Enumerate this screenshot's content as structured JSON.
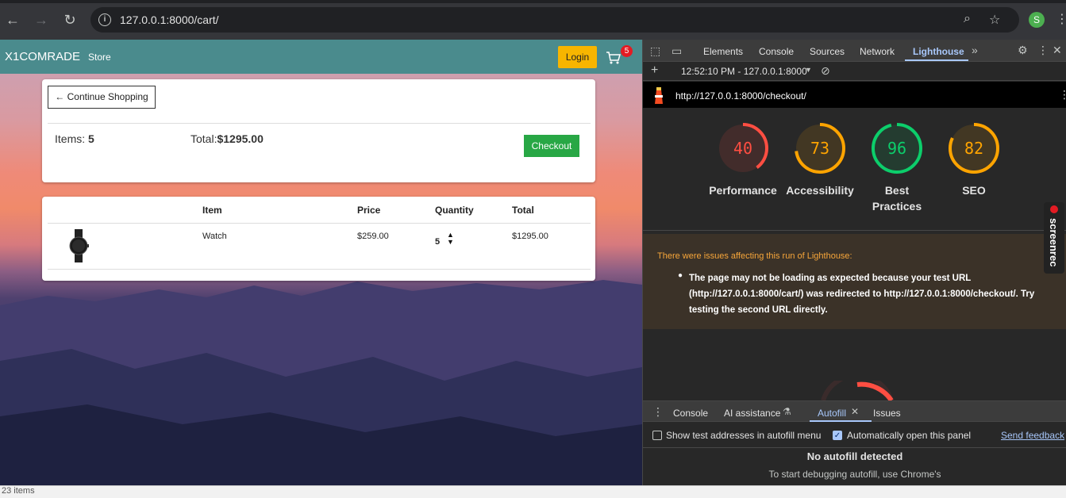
{
  "browser": {
    "url": "127.0.0.1:8000/cart/",
    "avatar_letter": "S"
  },
  "site": {
    "brand": "X1COMRADE",
    "store_link": "Store",
    "login_label": "Login",
    "cart_count": "5"
  },
  "summary": {
    "continue_label": "← Continue Shopping",
    "items_prefix": "Items: ",
    "items_value": "5",
    "total_prefix": "Total:",
    "total_value": "$1295.00",
    "checkout_label": "Checkout"
  },
  "cart_table": {
    "headers": [
      "Item",
      "Price",
      "Quantity",
      "Total"
    ],
    "rows": [
      {
        "item": "Watch",
        "price": "$259.00",
        "quantity": "5",
        "total": "$1295.00"
      }
    ]
  },
  "devtools": {
    "tabs": [
      "Elements",
      "Console",
      "Sources",
      "Network",
      "Lighthouse"
    ],
    "active_tab": "Lighthouse",
    "report_time": "12:52:10 PM - 127.0.0.1:8000",
    "report_url": "http://127.0.0.1:8000/checkout/",
    "scores": [
      {
        "label": "Performance",
        "value": 40,
        "color": "#ff4e42"
      },
      {
        "label": "Accessibility",
        "value": 73,
        "color": "#ffa400"
      },
      {
        "label": "Best Practices",
        "value": 96,
        "color": "#0cce6b"
      },
      {
        "label": "SEO",
        "value": 82,
        "color": "#ffa400"
      }
    ],
    "warning_title": "There were issues affecting this run of Lighthouse:",
    "warning_text": "The page may not be loading as expected because your test URL (http://127.0.0.1:8000/cart/) was redirected to http://127.0.0.1:8000/checkout/. Try testing the second URL directly.",
    "screenrec_label": "screenrec",
    "bottom_tabs": [
      "Console",
      "AI assistance",
      "Autofill",
      "Issues"
    ],
    "bottom_active": "Autofill",
    "show_test_addresses": "Show test addresses in autofill menu",
    "auto_open": "Automatically open this panel",
    "send_feedback": "Send feedback",
    "no_autofill": "No autofill detected",
    "autofill_hint": "To start debugging autofill, use Chrome's"
  },
  "status_bar": {
    "text": "23 items"
  }
}
